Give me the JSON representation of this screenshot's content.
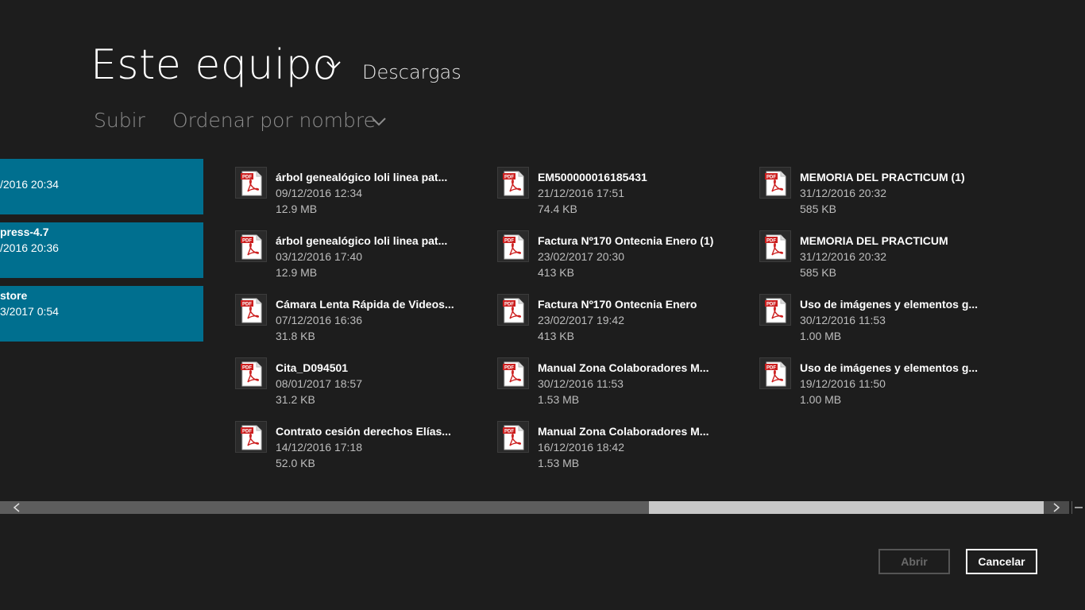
{
  "header": {
    "title": "Este equipo",
    "breadcrumb": "Descargas"
  },
  "commands": {
    "up_label": "Subir",
    "sort_label": "Ordenar por nombre"
  },
  "folders": [
    {
      "name": "",
      "date": "/2016 20:34"
    },
    {
      "name": "press-4.7",
      "date": "/2016 20:36"
    },
    {
      "name": "store",
      "date": "3/2017 0:54"
    }
  ],
  "files": [
    {
      "name": "árbol genealógico loli linea pat...",
      "date": "09/12/2016 12:34",
      "size": "12.9 MB",
      "icon": "pdf-file-icon"
    },
    {
      "name": "árbol genealógico loli linea pat...",
      "date": "03/12/2016 17:40",
      "size": "12.9 MB",
      "icon": "pdf-file-icon"
    },
    {
      "name": "Cámara Lenta Rápida de Videos...",
      "date": "07/12/2016 16:36",
      "size": "31.8 KB",
      "icon": "pdf-file-icon"
    },
    {
      "name": "Cita_D094501",
      "date": "08/01/2017 18:57",
      "size": "31.2 KB",
      "icon": "pdf-file-icon"
    },
    {
      "name": "Contrato cesión derechos Elías...",
      "date": "14/12/2016 17:18",
      "size": "52.0 KB",
      "icon": "pdf-file-icon"
    },
    {
      "name": "EM500000016185431",
      "date": "21/12/2016 17:51",
      "size": "74.4 KB",
      "icon": "pdf-file-icon"
    },
    {
      "name": "Factura Nº170 Ontecnia Enero (1)",
      "date": "23/02/2017 20:30",
      "size": "413 KB",
      "icon": "pdf-file-icon"
    },
    {
      "name": "Factura Nº170 Ontecnia Enero",
      "date": "23/02/2017 19:42",
      "size": "413 KB",
      "icon": "pdf-file-icon"
    },
    {
      "name": "Manual Zona Colaboradores M...",
      "date": "30/12/2016 11:53",
      "size": "1.53 MB",
      "icon": "pdf-file-icon"
    },
    {
      "name": "Manual Zona Colaboradores M...",
      "date": "16/12/2016 18:42",
      "size": "1.53 MB",
      "icon": "pdf-file-icon"
    },
    {
      "name": "MEMORIA DEL PRACTICUM (1)",
      "date": "31/12/2016 20:32",
      "size": "585 KB",
      "icon": "pdf-file-icon"
    },
    {
      "name": "MEMORIA DEL PRACTICUM",
      "date": "31/12/2016 20:32",
      "size": "585 KB",
      "icon": "pdf-file-icon"
    },
    {
      "name": "Uso de imágenes y elementos g...",
      "date": "30/12/2016 11:53",
      "size": "1.00 MB",
      "icon": "pdf-file-icon"
    },
    {
      "name": "Uso de imágenes y elementos g...",
      "date": "19/12/2016 11:50",
      "size": "1.00 MB",
      "icon": "pdf-file-icon"
    }
  ],
  "icons": {
    "pdf_badge_text": "PDF",
    "pdf_red": "#cc1f1f"
  },
  "buttons": {
    "open_label": "Abrir",
    "cancel_label": "Cancelar"
  },
  "colors": {
    "background": "#1d1d1d",
    "folder_tile": "#006f8f",
    "scroll_track": "#5d5d5d",
    "scroll_thumb": "#c8c8c8"
  }
}
